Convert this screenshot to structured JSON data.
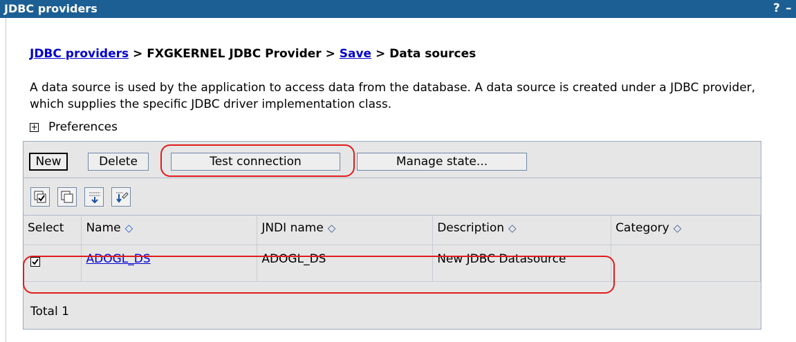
{
  "window": {
    "title": "JDBC providers",
    "help_label": "?",
    "minimize_label": "–"
  },
  "breadcrumb": {
    "link1": "JDBC providers",
    "sep1": " > FXGKERNEL JDBC Provider > ",
    "link2": "Save",
    "sep2": " > Data sources"
  },
  "intro": "A data source is used by the application to access data from the database. A data source is created under a JDBC provider, which supplies the specific JDBC driver implementation class.",
  "preferences": {
    "label": "Preferences",
    "toggle": "+"
  },
  "toolbar": {
    "new_label": "New",
    "delete_label": "Delete",
    "test_label": "Test connection",
    "manage_label": "Manage state..."
  },
  "icon_toolbar": [
    "select-all-icon",
    "deselect-all-icon",
    "show-filter-icon",
    "clear-filter-icon"
  ],
  "table": {
    "headers": {
      "select": "Select",
      "name": "Name",
      "jndi": "JNDI name",
      "description": "Description",
      "category": "Category"
    },
    "sort_glyph": "◇",
    "sort_active_glyph": "◇",
    "rows": [
      {
        "selected": true,
        "name": "ADOGL_DS",
        "jndi": "ADOGL_DS",
        "description": "New JDBC Datasource",
        "category": ""
      }
    ],
    "total": "Total 1"
  },
  "colors": {
    "titlebar": "#1c5f94",
    "highlight": "#e21b1b",
    "link": "#0000cc",
    "panel": "#e6e6e6"
  }
}
